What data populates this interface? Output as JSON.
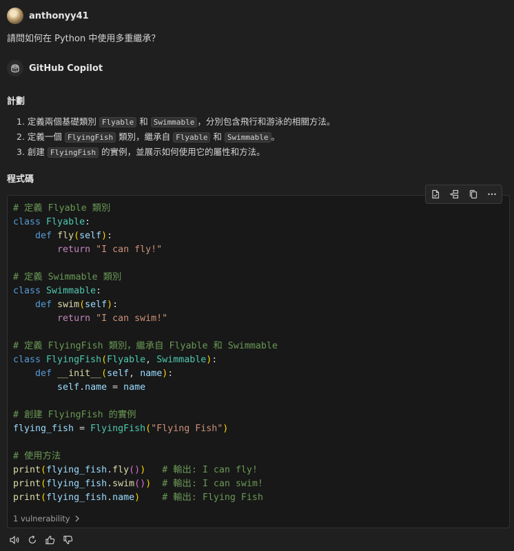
{
  "user": {
    "name": "anthonyy41",
    "question": "請問如何在 Python 中使用多重繼承？"
  },
  "assistant": {
    "name": "GitHub Copilot"
  },
  "plan": {
    "heading": "計劃",
    "items": [
      {
        "n": "1.",
        "t1": "定義兩個基礎類別 ",
        "c1": "Flyable",
        "t2": " 和 ",
        "c2": "Swimmable",
        "t3": "，分別包含飛行和游泳的相關方法。"
      },
      {
        "n": "2.",
        "t1": "定義一個 ",
        "c1": "FlyingFish",
        "t2": " 類別，繼承自 ",
        "c2": "Flyable",
        "t3": " 和 ",
        "c3": "Swimmable",
        "t4": "。"
      },
      {
        "n": "3.",
        "t1": "創建 ",
        "c1": "FlyingFish",
        "t2": " 的實例，並展示如何使用它的屬性和方法。"
      }
    ]
  },
  "code_section": {
    "heading": "程式碼",
    "tokens": {
      "c1": "# 定義 Flyable 類別",
      "kw_class": "class",
      "Flyable": "Flyable",
      "colon": ":",
      "kw_def": "def",
      "fly": "fly",
      "self": "self",
      "po": "(",
      "pc": ")",
      "kw_return": "return",
      "s_fly": "\"I can fly!\"",
      "c2": "# 定義 Swimmable 類別",
      "Swimmable": "Swimmable",
      "swim": "swim",
      "s_swim": "\"I can swim!\"",
      "c3": "# 定義 FlyingFish 類別，繼承自 Flyable 和 Swimmable",
      "FlyingFish": "FlyingFish",
      "comma": ", ",
      "init": "__init__",
      "name": "name",
      "dot": ".",
      "eq": " = ",
      "c4": "# 創建 FlyingFish 的實例",
      "flying_fish": "flying_fish",
      "s_ff": "\"Flying Fish\"",
      "c5": "# 使用方法",
      "print": "print",
      "c6": "# 輸出: I can fly!",
      "c7": "# 輸出: I can swim!",
      "c8": "# 輸出: Flying Fish"
    },
    "vulnerability_label": "1 vulnerability"
  },
  "icons": {
    "toolbar": [
      "apply-in-editor-icon",
      "insert-at-cursor-icon",
      "copy-icon",
      "more-actions-icon"
    ],
    "actions": [
      "read-aloud-icon",
      "retry-icon",
      "thumbs-up-icon",
      "thumbs-down-icon"
    ]
  }
}
